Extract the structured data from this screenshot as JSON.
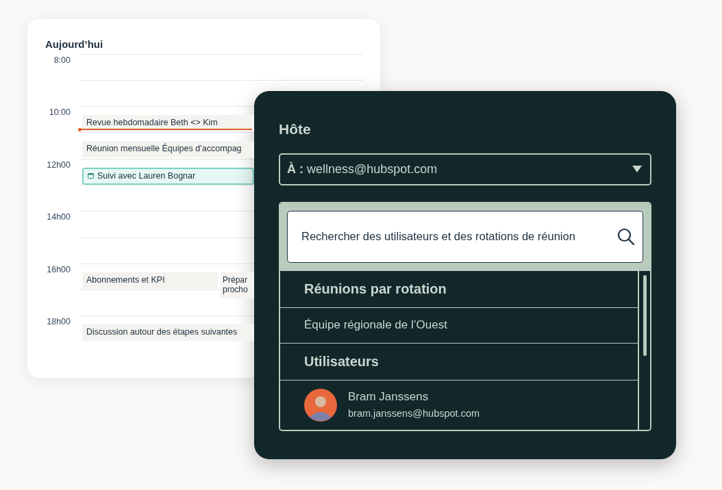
{
  "calendar": {
    "title": "Aujourd’hui",
    "rows": [
      {
        "label": "8:00",
        "current_time": false,
        "events": []
      },
      {
        "current_time": false,
        "events": []
      },
      {
        "label": "10:00",
        "current_time": true,
        "events": [
          {
            "kind": "plain",
            "title": "Revue hebdomadaire Beth <> Kim"
          }
        ]
      },
      {
        "current_time": false,
        "events": [
          {
            "kind": "plain",
            "title": "Réunion mensuelle Équipes d’accompag"
          }
        ]
      },
      {
        "label": "12h00",
        "current_time": false,
        "events": [
          {
            "kind": "highlighted",
            "title": "Suivi avec Lauren Bognar"
          }
        ]
      },
      {
        "current_time": false,
        "events": []
      },
      {
        "label": "14h00",
        "current_time": false,
        "events": []
      },
      {
        "current_time": false,
        "events": []
      },
      {
        "label": "16h00",
        "current_time": false,
        "events": [
          {
            "kind": "plain",
            "title": "Abonnements et KPI"
          },
          {
            "kind": "plain",
            "title": "Prépar\nprocho"
          }
        ]
      },
      {
        "current_time": false,
        "events": []
      },
      {
        "label": "18h00",
        "current_time": false,
        "events": [
          {
            "kind": "plain",
            "title": "Discussion autour des étapes suivantes"
          }
        ]
      }
    ]
  },
  "host_panel": {
    "title": "Hôte",
    "select": {
      "value": "**À :** wellness@hubspot.com"
    },
    "search": {
      "placeholder": "Rechercher des utilisateurs et des rotations de réunion"
    },
    "list": [
      {
        "kind": "header",
        "label": "Réunions par rotation"
      },
      {
        "kind": "item",
        "label": "Équipe régionale de l’Ouest"
      },
      {
        "kind": "header",
        "label": "Utilisateurs"
      },
      {
        "kind": "user",
        "name": "Bram Janssens",
        "email": "bram.janssens@hubspot.com"
      }
    ]
  }
}
